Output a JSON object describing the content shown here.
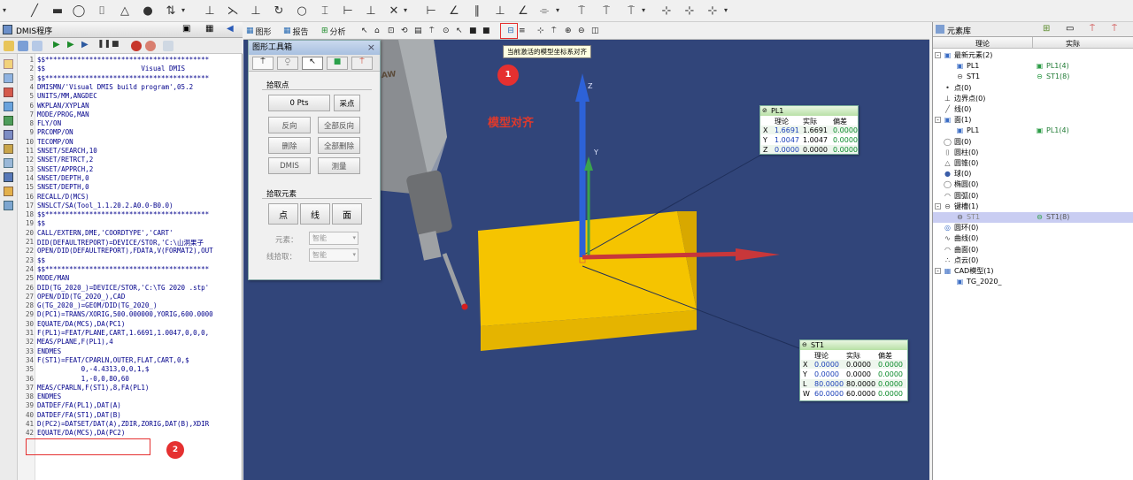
{
  "dmis_window": {
    "title": "DMIS程序"
  },
  "code_lines": [
    "$$*****************************************",
    "$$                        Visual DMIS",
    "$$*****************************************",
    "DMISMN/'Visual DMIS build program',05.2",
    "UNITS/MM,ANGDEC",
    "WKPLAN/XYPLAN",
    "MODE/PROG,MAN",
    "FLY/ON",
    "PRCOMP/ON",
    "TECOMP/ON",
    "SNSET/SEARCH,10",
    "SNSET/RETRCT,2",
    "SNSET/APPRCH,2",
    "SNSET/DEPTH,0",
    "SNSET/DEPTH,0",
    "RECALL/D(MCS)",
    "SNSLCT/SA(Tool_1.1.20.2.A0.0-B0.0)",
    "$$*****************************************",
    "$$",
    "CALL/EXTERN,DME,'COORDTYPE','CART'",
    "DID(DEFAULTREPORT)=DEVICE/STOR,'C:\\山洞果子",
    "OPEN/DID(DEFAULTREPORT),FDATA,V(FORMAT2),OUT",
    "$$",
    "$$*****************************************",
    "MODE/MAN",
    "DID(TG_2020_)=DEVICE/STOR,'C:\\TG 2020 .stp'",
    "OPEN/DID(TG_2020_),CAD",
    "G(TG_2020_)=GEOM/DID(TG_2020_)",
    "D(PC1)=TRANS/XORIG,500.000000,YORIG,600.0000",
    "EQUATE/DA(MCS),DA(PC1)",
    "F(PL1)=FEAT/PLANE,CART,1.6691,1.0047,0,0,0,",
    "MEAS/PLANE,F(PL1),4",
    "ENDMES",
    "F(ST1)=FEAT/CPARLN,OUTER,FLAT,CART,0,$",
    "           0,-4.4313,0,0,1,$",
    "           1,-0,0,80,60",
    "MEAS/CPARLN,F(ST1),8,FA(PL1)",
    "ENDMES",
    "DATDEF/FA(PL1),DAT(A)",
    "DATDEF/FA(ST1),DAT(B)",
    "D(PC2)=DATSET/DAT(A),ZDIR,ZORIG,DAT(B),XDIR",
    "EQUATE/DA(MCS),DA(PC2)"
  ],
  "viewport_toolbar": {
    "graphics": "图形",
    "report": "报告",
    "analysis": "分析"
  },
  "tooltip": "当前激活的模型坐标系对齐",
  "overlay_label": "模型对齐",
  "markers": {
    "m1": "1",
    "m2": "2"
  },
  "probe_brand": "SHAW",
  "graphics_toolbox": {
    "title": "图形工具箱",
    "close": "×",
    "pick_points": "拾取点",
    "pts": "0 Pts",
    "capture": "采点",
    "reverse": "反向",
    "all_reverse": "全部反向",
    "delete": "删除",
    "delete_all": "全部删除",
    "dmis": "DMIS",
    "measure": "测量",
    "pick_elements": "拾取元素",
    "point": "点",
    "line": "线",
    "plane": "面",
    "element_label": "元素：",
    "element_value": "智能",
    "line_pick_label": "线拾取：",
    "line_pick_value": "智能"
  },
  "pl1_dialog": {
    "title": "PL1",
    "headers": [
      "理论",
      "实际",
      "偏差"
    ],
    "rows": [
      {
        "axis": "X",
        "theory": "1.6691",
        "actual": "1.6691",
        "dev": "0.0000"
      },
      {
        "axis": "Y",
        "theory": "1.0047",
        "actual": "1.0047",
        "dev": "0.0000"
      },
      {
        "axis": "Z",
        "theory": "0.0000",
        "actual": "0.0000",
        "dev": "0.0000"
      }
    ]
  },
  "st1_dialog": {
    "title": "ST1",
    "headers": [
      "理论",
      "实际",
      "偏差"
    ],
    "rows": [
      {
        "axis": "X",
        "theory": "0.0000",
        "actual": "0.0000",
        "dev": "0.0000"
      },
      {
        "axis": "Y",
        "theory": "0.0000",
        "actual": "0.0000",
        "dev": "0.0000"
      },
      {
        "axis": "L",
        "theory": "80.0000",
        "actual": "80.0000",
        "dev": "0.0000"
      },
      {
        "axis": "W",
        "theory": "60.0000",
        "actual": "60.0000",
        "dev": "0.0000"
      }
    ]
  },
  "axis_labels": {
    "z": "Z",
    "y": "Y"
  },
  "element_library": {
    "title": "元素库",
    "col_theory": "理论",
    "col_actual": "实际",
    "rows": [
      {
        "label": "最新元素(2)",
        "actual": ""
      },
      {
        "label": "PL1",
        "actual": "PL1(4)"
      },
      {
        "label": "ST1",
        "actual": "ST1(8)"
      },
      {
        "label": "点(0)",
        "actual": ""
      },
      {
        "label": "边界点(0)",
        "actual": ""
      },
      {
        "label": "线(0)",
        "actual": ""
      },
      {
        "label": "面(1)",
        "actual": ""
      },
      {
        "label": "PL1",
        "actual": "PL1(4)"
      },
      {
        "label": "圆(0)",
        "actual": ""
      },
      {
        "label": "圆柱(0)",
        "actual": ""
      },
      {
        "label": "圆锥(0)",
        "actual": ""
      },
      {
        "label": "球(0)",
        "actual": ""
      },
      {
        "label": "椭圆(0)",
        "actual": ""
      },
      {
        "label": "圆弧(0)",
        "actual": ""
      },
      {
        "label": "键槽(1)",
        "actual": ""
      },
      {
        "label": "ST1",
        "actual": "ST1(8)"
      },
      {
        "label": "圆环(0)",
        "actual": ""
      },
      {
        "label": "曲线(0)",
        "actual": ""
      },
      {
        "label": "曲面(0)",
        "actual": ""
      },
      {
        "label": "点云(0)",
        "actual": ""
      },
      {
        "label": "CAD模型(1)",
        "actual": ""
      },
      {
        "label": "TG_2020_",
        "actual": ""
      }
    ]
  },
  "colors": {
    "viewport_bg": "#31457a",
    "block": "#f5c400",
    "x_axis": "#c8373a",
    "y_axis": "#3aa34d",
    "z_axis": "#2d62d8",
    "marker": "#e53030",
    "overlay_text": "#e0392b"
  }
}
